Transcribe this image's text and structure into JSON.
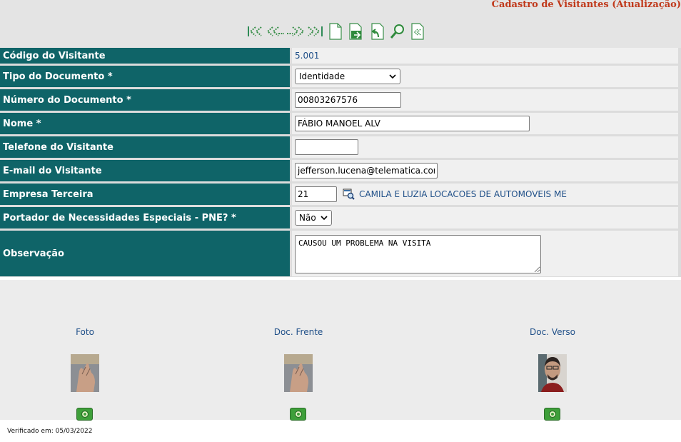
{
  "header": {
    "title": "Cadastro de Visitantes (Atualização)",
    "toolbar": [
      {
        "name": "first-record-icon",
        "label": "Primeiro"
      },
      {
        "name": "previous-record-icon",
        "label": "Anterior"
      },
      {
        "name": "next-record-icon",
        "label": "Próximo"
      },
      {
        "name": "last-record-icon",
        "label": "Último"
      },
      {
        "name": "new-record-icon",
        "label": "Novo"
      },
      {
        "name": "save-record-icon",
        "label": "Salvar"
      },
      {
        "name": "undo-icon",
        "label": "Desfazer"
      },
      {
        "name": "search-icon",
        "label": "Pesquisar"
      },
      {
        "name": "back-icon",
        "label": "Voltar"
      }
    ]
  },
  "form": {
    "codigo": {
      "label": "Código do Visitante",
      "value": "5.001"
    },
    "tipo_documento": {
      "label": "Tipo do Documento *",
      "value": "Identidade"
    },
    "numero_documento": {
      "label": "Número do Documento *",
      "value": "00803267576"
    },
    "nome": {
      "label": "Nome *",
      "value": "FÁBIO MANOEL ALV"
    },
    "telefone": {
      "label": "Telefone do Visitante",
      "value": ""
    },
    "email": {
      "label": "E-mail do Visitante",
      "value": "jefferson.lucena@telematica.com"
    },
    "empresa": {
      "label": "Empresa Terceira",
      "code": "21",
      "name": "CAMILA E LUZIA LOCACOES DE AUTOMOVEIS ME"
    },
    "pne": {
      "label": "Portador de Necessidades Especiais - PNE? *",
      "value": "Não"
    },
    "observacao": {
      "label": "Observação",
      "value": "CAUSOU UM PROBLEMA NA VISITA"
    }
  },
  "photos": {
    "foto": {
      "caption": "Foto"
    },
    "doc_frente": {
      "caption": "Doc. Frente"
    },
    "doc_verso": {
      "caption": "Doc. Verso"
    }
  },
  "footer": {
    "text": "Verificado em: 05/03/2022"
  },
  "colors": {
    "label_bg": "#0f6468",
    "title": "#c0391b",
    "link": "#1f4f88",
    "camera_button": "#3e9f3a"
  }
}
